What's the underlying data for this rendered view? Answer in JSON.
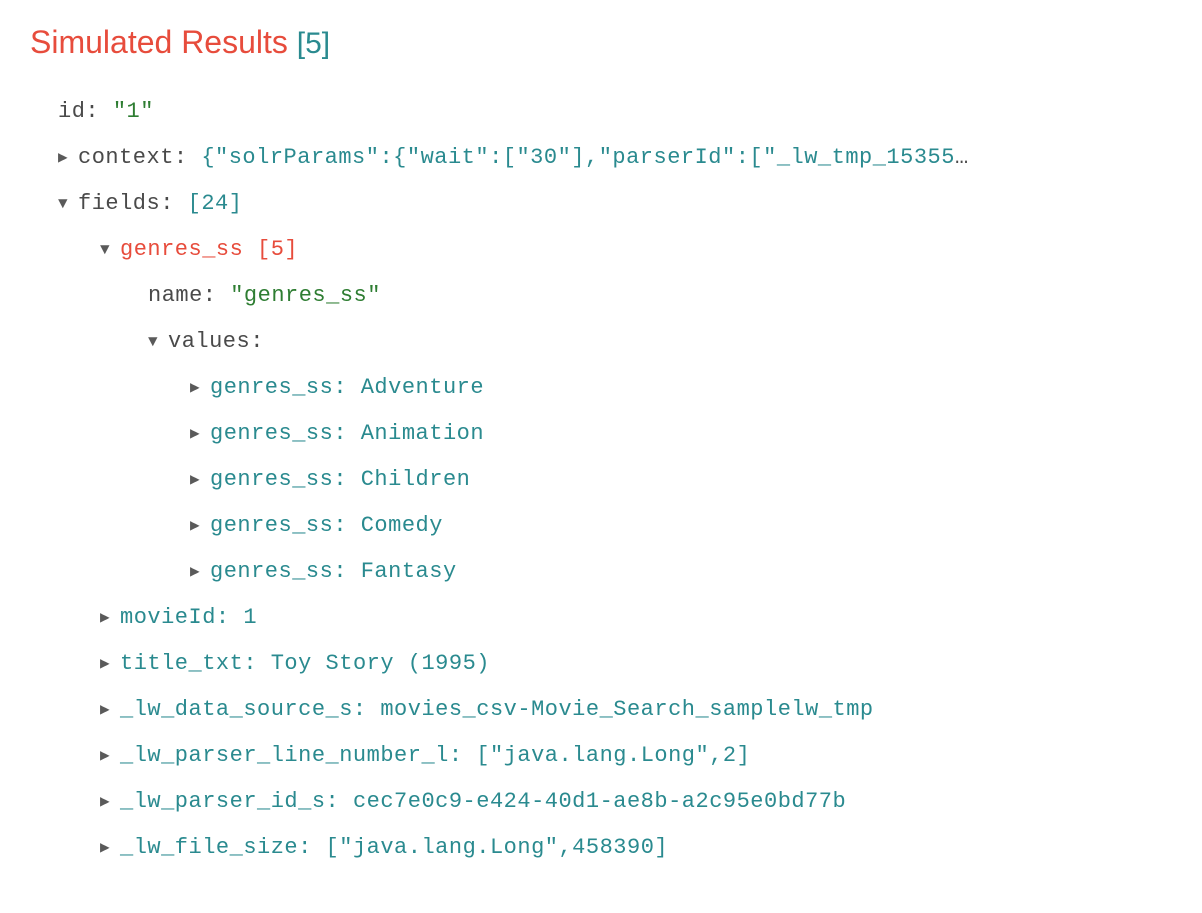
{
  "heading": {
    "title": "Simulated Results",
    "count": "[5]"
  },
  "row_id": {
    "key": "id:",
    "val": "\"1\""
  },
  "row_context": {
    "key": "context:",
    "val": "{\"solrParams\":{\"wait\":[\"30\"],\"parserId\":[\"_lw_tmp_15355"
  },
  "row_fields": {
    "key": "fields:",
    "count": "[24]"
  },
  "row_genres": {
    "key": "genres_ss",
    "count": "[5]"
  },
  "row_name": {
    "key": "name:",
    "val": "\"genres_ss\""
  },
  "row_values": {
    "key": "values:"
  },
  "genre_items": [
    {
      "key": "genres_ss:",
      "val": "Adventure"
    },
    {
      "key": "genres_ss:",
      "val": "Animation"
    },
    {
      "key": "genres_ss:",
      "val": "Children"
    },
    {
      "key": "genres_ss:",
      "val": "Comedy"
    },
    {
      "key": "genres_ss:",
      "val": "Fantasy"
    }
  ],
  "field_items": [
    {
      "key": "movieId:",
      "val": "1"
    },
    {
      "key": "title_txt:",
      "val": "Toy Story (1995)"
    },
    {
      "key": "_lw_data_source_s:",
      "val": "movies_csv-Movie_Search_samplelw_tmp"
    },
    {
      "key": "_lw_parser_line_number_l:",
      "val": "[\"java.lang.Long\",2]"
    },
    {
      "key": "_lw_parser_id_s:",
      "val": "cec7e0c9-e424-40d1-ae8b-a2c95e0bd77b"
    },
    {
      "key": "_lw_file_size:",
      "val": "[\"java.lang.Long\",458390]"
    }
  ]
}
